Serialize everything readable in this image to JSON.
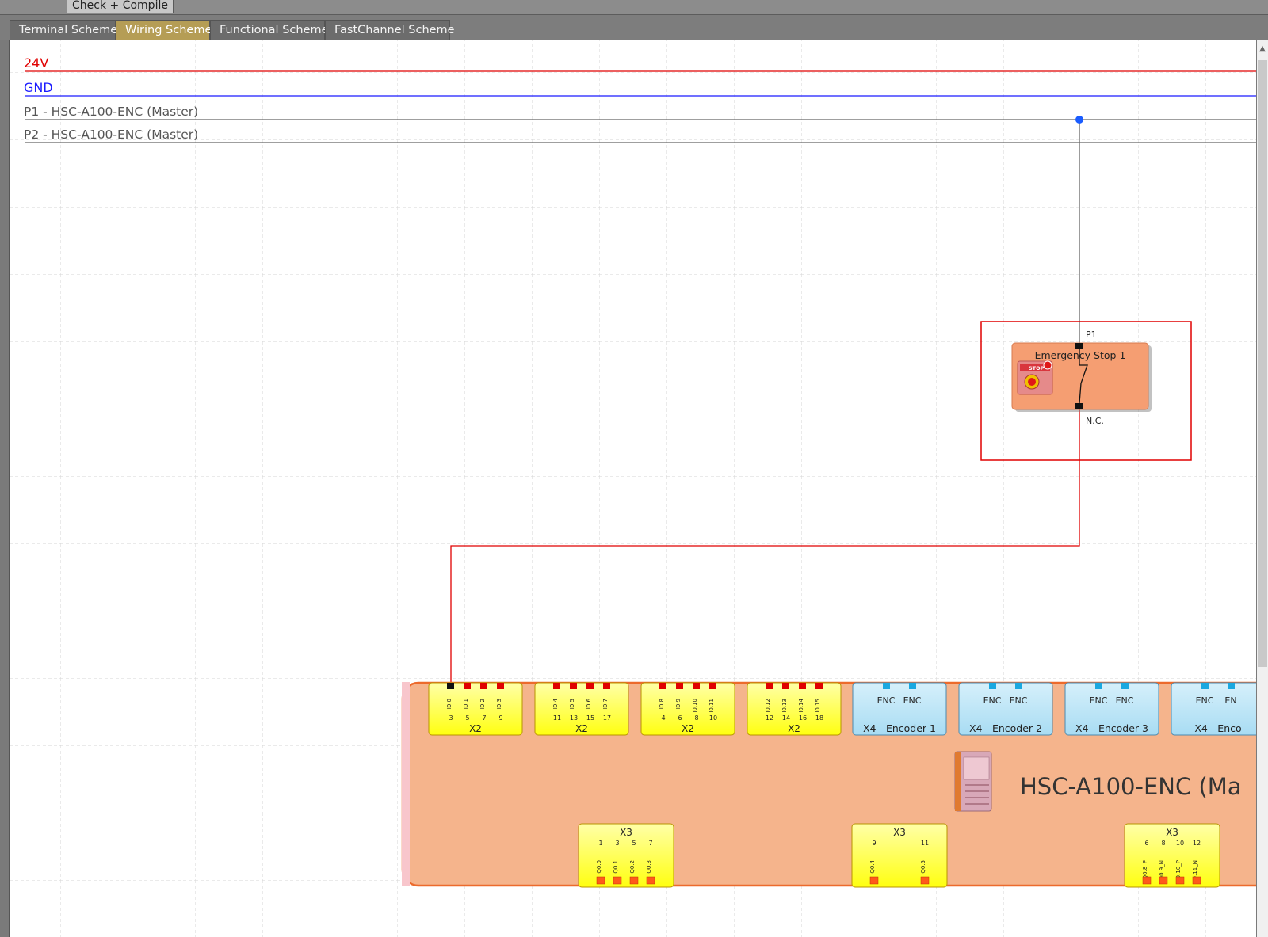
{
  "toolbar": {
    "check_compile_label": "Check + Compile"
  },
  "tabs": [
    {
      "label": "Terminal Scheme",
      "active": false
    },
    {
      "label": "Wiring Scheme",
      "active": true
    },
    {
      "label": "Functional Scheme",
      "active": false
    },
    {
      "label": "FastChannel Scheme",
      "active": false
    }
  ],
  "rails": {
    "v24": {
      "label": "24V",
      "color": "#e00000"
    },
    "gnd": {
      "label": "GND",
      "color": "#1a1aff"
    },
    "p1": {
      "label": "P1 - HSC-A100-ENC (Master)",
      "color": "#555555"
    },
    "p2": {
      "label": "P2 - HSC-A100-ENC (Master)",
      "color": "#555555"
    }
  },
  "estop": {
    "title": "Emergency Stop 1",
    "top_pin": "P1",
    "bottom_pin": "N.C.",
    "badge": "STOP"
  },
  "module": {
    "name": "HSC-A100-ENC (Ma",
    "x2_blocks": [
      {
        "label": "X2",
        "pins": [
          "I0.0",
          "I0.1",
          "I0.2",
          "I0.3"
        ],
        "nums": [
          "3",
          "5",
          "7",
          "9"
        ]
      },
      {
        "label": "X2",
        "pins": [
          "I0.4",
          "I0.5",
          "I0.6",
          "I0.7"
        ],
        "nums": [
          "11",
          "13",
          "15",
          "17"
        ]
      },
      {
        "label": "X2",
        "pins": [
          "I0.8",
          "I0.9",
          "I0.10",
          "I0.11"
        ],
        "nums": [
          "4",
          "6",
          "8",
          "10"
        ]
      },
      {
        "label": "X2",
        "pins": [
          "I0.12",
          "I0.13",
          "I0.14",
          "I0.15"
        ],
        "nums": [
          "12",
          "14",
          "16",
          "18"
        ]
      }
    ],
    "encoders": [
      {
        "label": "X4 - Encoder 1",
        "pins": [
          "ENC",
          "ENC"
        ]
      },
      {
        "label": "X4 - Encoder 2",
        "pins": [
          "ENC",
          "ENC"
        ]
      },
      {
        "label": "X4 - Encoder 3",
        "pins": [
          "ENC",
          "ENC"
        ]
      },
      {
        "label": "X4 - Enco",
        "pins": [
          "ENC",
          "EN"
        ]
      }
    ],
    "x3_blocks": [
      {
        "label": "X3",
        "nums": [
          "1",
          "3",
          "5",
          "7"
        ],
        "pins": [
          "Q0.0",
          "Q0.1",
          "Q0.2",
          "Q0.3"
        ]
      },
      {
        "label": "X3",
        "nums": [
          "9",
          "11"
        ],
        "pins": [
          "Q0.4",
          "Q0.5"
        ]
      },
      {
        "label": "X3",
        "nums": [
          "6",
          "8",
          "10",
          "12"
        ],
        "pins": [
          "Q0.8_P",
          "Q0.9_N",
          "Q0.10_P",
          "Q0.11_N"
        ]
      }
    ]
  }
}
